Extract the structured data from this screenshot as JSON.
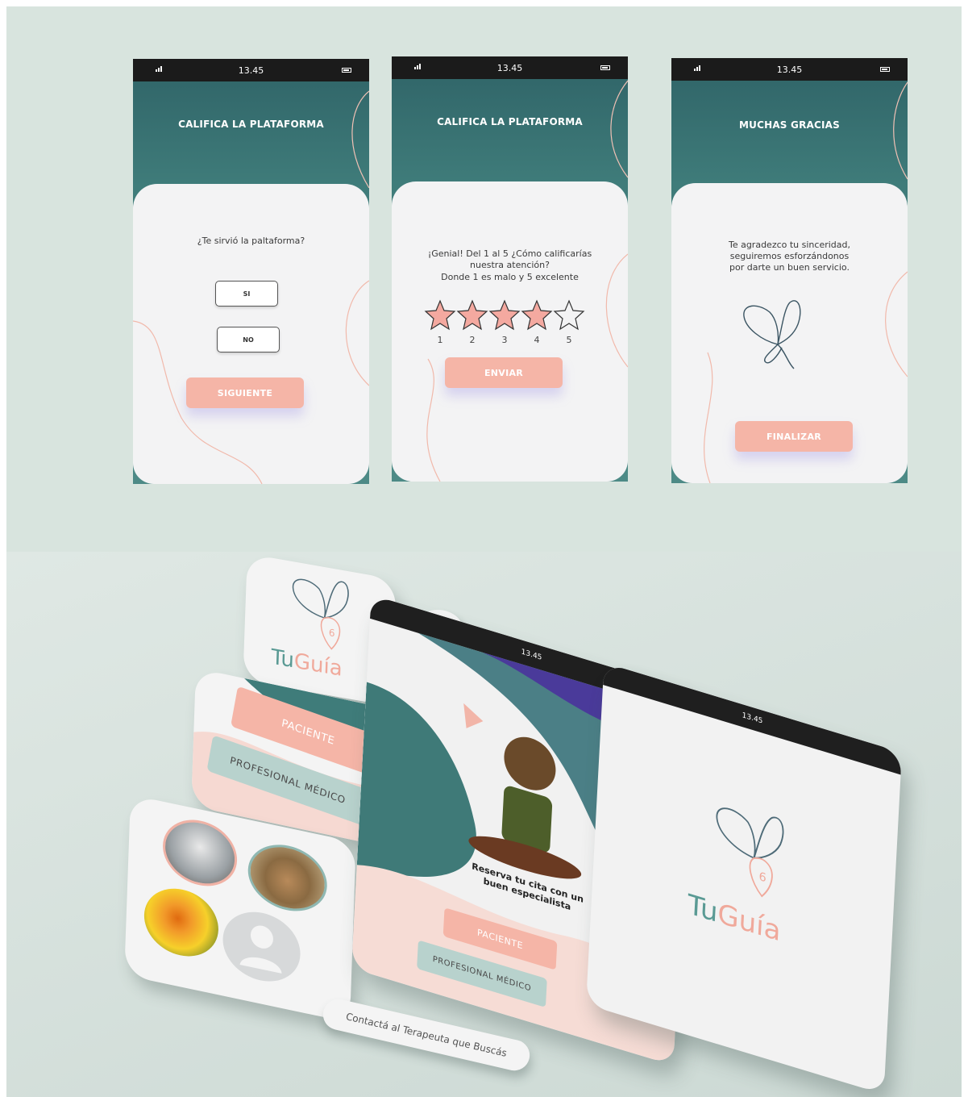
{
  "colors": {
    "teal_dark": "#2f6367",
    "teal": "#4d8a86",
    "pink": "#f5b5a7",
    "card_bg": "#f3f3f4",
    "mint_bg": "#d8e4de",
    "mint_btn": "#b8d2cd"
  },
  "time": "13.45",
  "screen1": {
    "title": "CALIFICA LA PLATAFORMA",
    "question": "¿Te sirvió la paltaforma?",
    "yes_label": "SI",
    "no_label": "NO",
    "next_label": "SIGUIENTE"
  },
  "screen2": {
    "title": "CALIFICA LA PLATAFORMA",
    "question_line1": "¡Genial! Del 1 al 5 ¿Cómo calificarías",
    "question_line2": "nuestra atención?",
    "question_line3": "Donde 1 es malo y 5 excelente",
    "rating": 4,
    "rating_max": 5,
    "star_numbers": [
      "1",
      "2",
      "3",
      "4",
      "5"
    ],
    "send_label": "ENVIAR"
  },
  "screen3": {
    "title": "MUCHAS GRACIAS",
    "message_line1": "Te agradezco tu sinceridad,",
    "message_line2": "seguiremos esforzándonos",
    "message_line3": "por darte un buen servicio.",
    "finish_label": "FINALIZAR",
    "icon": "butterfly-icon"
  },
  "mockup": {
    "logo_tu": "Tu",
    "logo_guia": "Guía",
    "patient_label": "PACIENTE",
    "professional_label": "PROFESIONAL MÉDICO",
    "tagline_line1": "Reserva tu cita con un",
    "tagline_line2": "buen especialista",
    "contact_label": "Contactá al Terapeuta que Buscás",
    "location_icon": "location-pin-icon",
    "video_icon": "play-icon",
    "avatars": [
      "wolf-avatar",
      "deer-avatar",
      "butterfly-avatar",
      "default-user-avatar"
    ]
  }
}
